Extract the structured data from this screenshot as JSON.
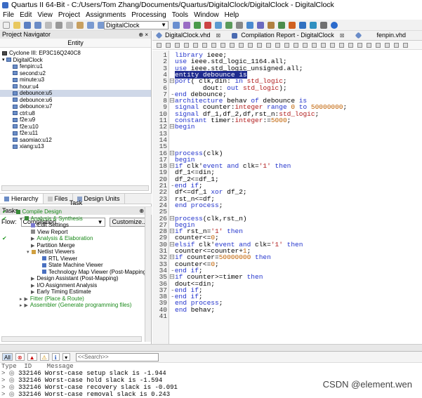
{
  "window": {
    "title": "Quartus II 64-Bit - C:/Users/Tom Zhang/Documents/Quartus/DigitalClock/DigitalClock - DigitalClock"
  },
  "menu": [
    "File",
    "Edit",
    "View",
    "Project",
    "Assignments",
    "Processing",
    "Tools",
    "Window",
    "Help"
  ],
  "toolbar": {
    "project_select": "DigitalClock"
  },
  "project_navigator": {
    "title": "Project Navigator",
    "entity_header": "Entity",
    "device": "Cyclone III: EP3C16Q240C8",
    "items": [
      "DigitalClock",
      "fenpin:u1",
      "second:u2",
      "minute:u3",
      "hour:u4",
      "debounce:u5",
      "debounce:u6",
      "debounce:u7",
      "ctrl:u8",
      "f2e:u9",
      "f2e:u10",
      "f2e:u11",
      "saomiao:u12",
      "xiang:u13"
    ],
    "tabs": [
      "Hierarchy",
      "Files",
      "Design Units"
    ]
  },
  "tasks": {
    "title": "Tasks",
    "flow_label": "Flow:",
    "flow_value": "Compilation",
    "customize": "Customize...",
    "task_header": "Task",
    "rows": [
      "Compile Design",
      "Analysis & Synthesis",
      "Edit Settings",
      "View Report",
      "Analysis & Elaboration",
      "Partition Merge",
      "Netlist Viewers",
      "RTL Viewer",
      "State Machine Viewer",
      "Technology Map Viewer (Post-Mapping)",
      "Design Assistant (Post-Mapping)",
      "I/O Assignment Analysis",
      "Early Timing Estimate",
      "Fitter (Place & Route)",
      "Assembler (Generate programming files)"
    ]
  },
  "editor": {
    "tabs": [
      "DigitalClock.vhd",
      "Compilation Report - DigitalClock",
      "fenpin.vhd"
    ],
    "line_numbers": [
      "1",
      "2",
      "3",
      "4",
      "5",
      "6",
      "7",
      "8",
      "9",
      "10",
      "11",
      "12",
      "13",
      "14",
      "15",
      "16",
      "17",
      "18",
      "19",
      "20",
      "21",
      "22",
      "23",
      "24",
      "25",
      "26",
      "27",
      "28",
      "29",
      "30",
      "31",
      "32",
      "33",
      "34",
      "35",
      "36",
      "37",
      "38",
      "39",
      "40",
      "41"
    ]
  },
  "messages": {
    "filter_all": "All",
    "search_placeholder": "<<Search>>",
    "header": "Type  ID    Message",
    "lines": [
      "332146 Worst-case setup slack is -1.944",
      "332146 Worst-case hold slack is -1.594",
      "332146 Worst-case recovery slack is -0.091",
      "332146 Worst-case removal slack is 0.243"
    ]
  },
  "watermark": "CSDN @element.wen"
}
